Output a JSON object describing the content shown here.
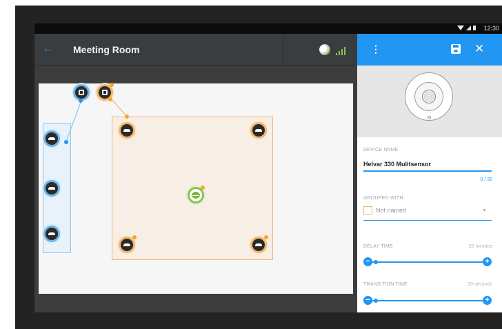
{
  "status": {
    "time": "12:30"
  },
  "appbar": {
    "back_icon": "arrow-back-icon",
    "title": "Meeting Room",
    "gauge_icon": "gauge-icon",
    "signal_icon": "signal-bars-icon"
  },
  "panel": {
    "menu_icon": "more-vert-icon",
    "save_icon": "save-icon",
    "close_icon": "close-icon",
    "device_name_label": "DEVICE NAME",
    "device_name_value": "Helvar 330 Mulitsensor",
    "device_name_counter": "0 / 32",
    "grouped_with_label": "GROUPED WITH",
    "grouped_with_value": "Not named",
    "delay_time_label": "DELAY TIME",
    "delay_time_value": "20 minutes",
    "delay_time_level": 0.05,
    "transition_time_label": "TRANSITION TIME",
    "transition_time_value": "20 seconds",
    "transition_time_level": 0.05
  },
  "colors": {
    "accent": "#2196f3",
    "zone": "#f2b56e",
    "sensor": "#8bc34a"
  }
}
